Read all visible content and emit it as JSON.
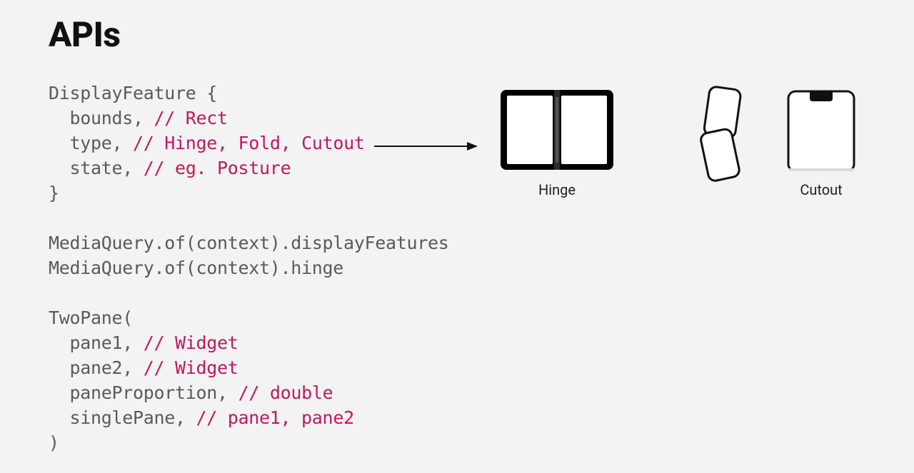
{
  "title": "APIs",
  "code": {
    "displayFeatureOpen": "DisplayFeature {",
    "boundsField": "bounds,",
    "boundsComment": "// Rect",
    "typeField": "type,",
    "typeComment": "// Hinge, Fold, Cutout",
    "stateField": "state,",
    "stateComment": "// eg. Posture",
    "displayFeatureClose": "}",
    "mq1": "MediaQuery.of(context).displayFeatures",
    "mq2": "MediaQuery.of(context).hinge",
    "twoPaneOpen": "TwoPane(",
    "pane1Field": "pane1,",
    "pane1Comment": "// Widget",
    "pane2Field": "pane2,",
    "pane2Comment": "// Widget",
    "panePropField": "paneProportion,",
    "panePropComment": "// double",
    "singlePaneField": "singlePane,",
    "singlePaneComment": "// pane1, pane2",
    "twoPaneClose": ")"
  },
  "devices": {
    "hingeLabel": "Hinge",
    "foldLabel": "",
    "cutoutLabel": "Cutout"
  }
}
